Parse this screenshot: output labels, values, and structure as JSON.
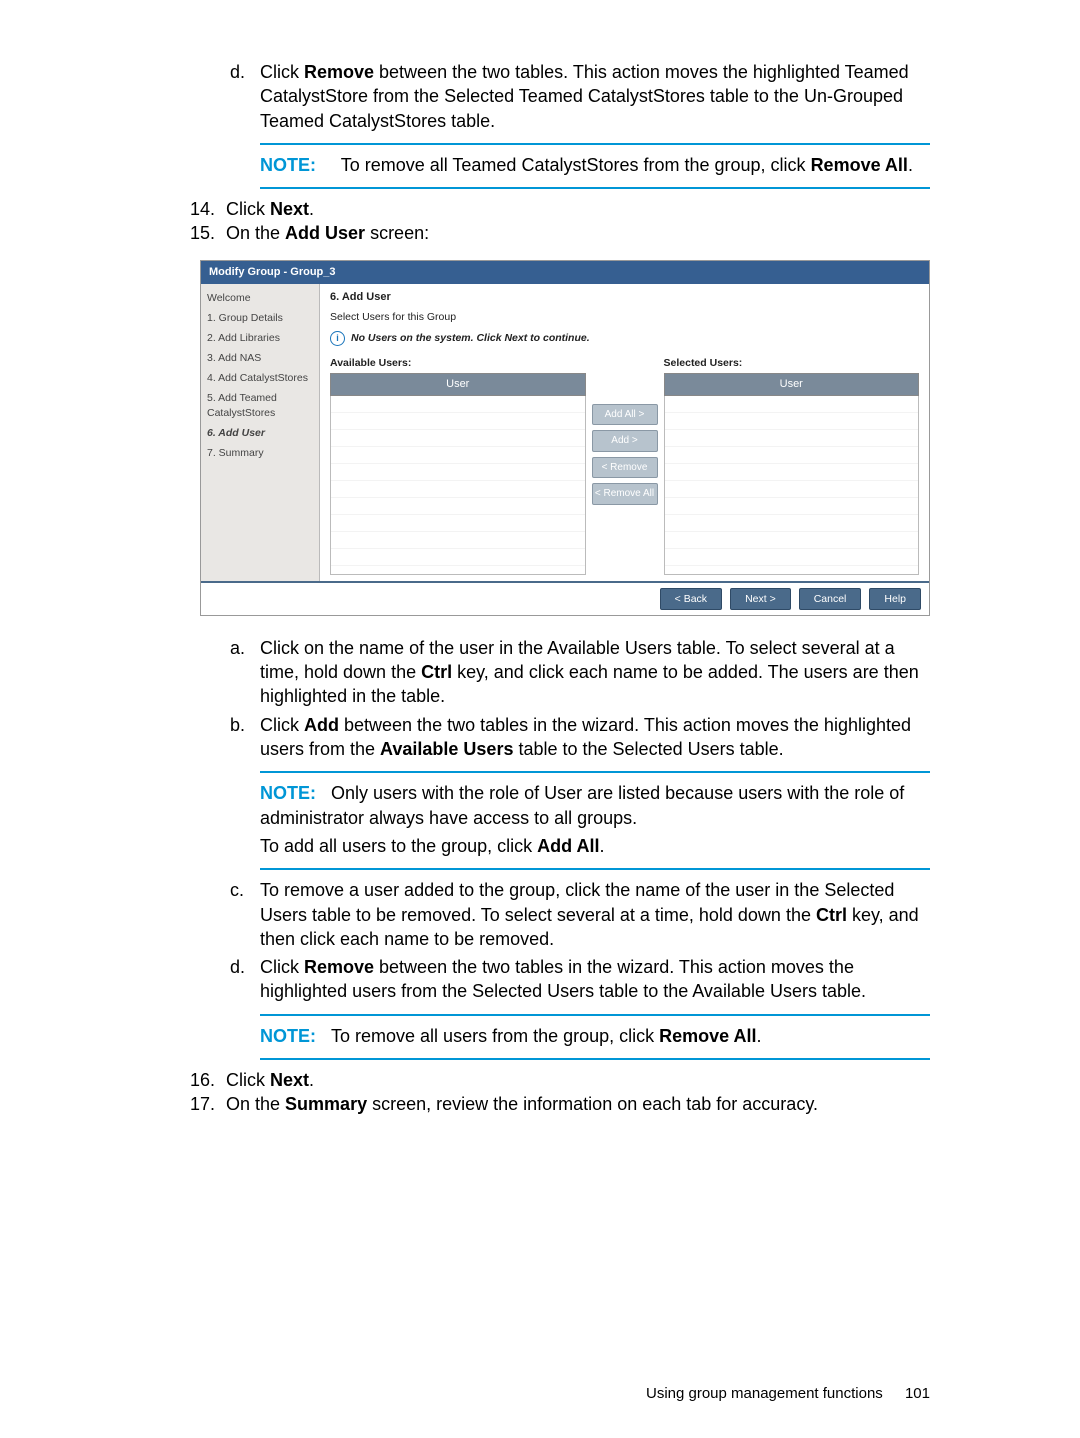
{
  "top_list": {
    "start": 4,
    "items": [
      {
        "marker": "d.",
        "pre": "Click ",
        "b1": "Remove",
        "post": " between the two tables. This action moves the highlighted Teamed CatalystStore from the Selected Teamed CatalystStores table to the Un-Grouped Teamed CatalystStores table."
      }
    ]
  },
  "note1": {
    "label": "NOTE:",
    "text_pre": "To remove all Teamed CatalystStores from the group, click ",
    "b": "Remove All",
    "text_post": "."
  },
  "steps_mid": [
    {
      "n": "14.",
      "pre": "Click ",
      "b": "Next",
      "post": "."
    },
    {
      "n": "15.",
      "pre": "On the ",
      "b": "Add User",
      "post": " screen:"
    }
  ],
  "wizard": {
    "title": "Modify Group - Group_3",
    "nav": [
      "Welcome",
      "1. Group Details",
      "2. Add Libraries",
      "3. Add NAS",
      "4. Add CatalystStores",
      "5. Add Teamed CatalystStores",
      "6. Add User",
      "7. Summary"
    ],
    "nav_active_index": 6,
    "step_heading": "6. Add User",
    "select_text": "Select Users for this Group",
    "info": "No Users on the system. Click Next to continue.",
    "available_label": "Available Users:",
    "selected_label": "Selected Users:",
    "col_header": "User",
    "buttons": [
      "Add All >",
      "Add >",
      "< Remove",
      "< Remove All"
    ],
    "footer": [
      "< Back",
      "Next >",
      "Cancel",
      "Help"
    ]
  },
  "sub_a": {
    "pre": "Click on the name of the user in the Available Users table. To select several at a time, hold down the ",
    "b": "Ctrl",
    "post": " key, and click each name to be added. The users are then highlighted in the table."
  },
  "sub_b": {
    "pre": "Click ",
    "b1": "Add",
    "mid": " between the two tables in the wizard. This action moves the highlighted users from the ",
    "b2": "Available Users",
    "post": " table to the Selected Users table."
  },
  "note2": {
    "label": "NOTE:",
    "line1": "Only users with the role of User are listed because users with the role of administrator always have access to all groups.",
    "line2_pre": "To add all users to the group, click ",
    "line2_b": "Add All",
    "line2_post": "."
  },
  "sub_c": {
    "pre": "To remove a user added to the group, click the name of the user in the Selected Users table to be removed. To select several at a time, hold down the ",
    "b": "Ctrl",
    "post": " key, and then click each name to be removed."
  },
  "sub_d": {
    "pre": "Click ",
    "b": "Remove",
    "post": " between the two tables in the wizard. This action moves the highlighted users from the Selected Users table to the Available Users table."
  },
  "note3": {
    "label": "NOTE:",
    "pre": "To remove all users from the group, click ",
    "b": "Remove All",
    "post": "."
  },
  "steps_end": [
    {
      "n": "16.",
      "pre": "Click ",
      "b": "Next",
      "post": "."
    },
    {
      "n": "17.",
      "pre": "On the ",
      "b": "Summary",
      "post": " screen, review the information on each tab for accuracy."
    }
  ],
  "footer": {
    "text": "Using group management functions",
    "page": "101"
  }
}
